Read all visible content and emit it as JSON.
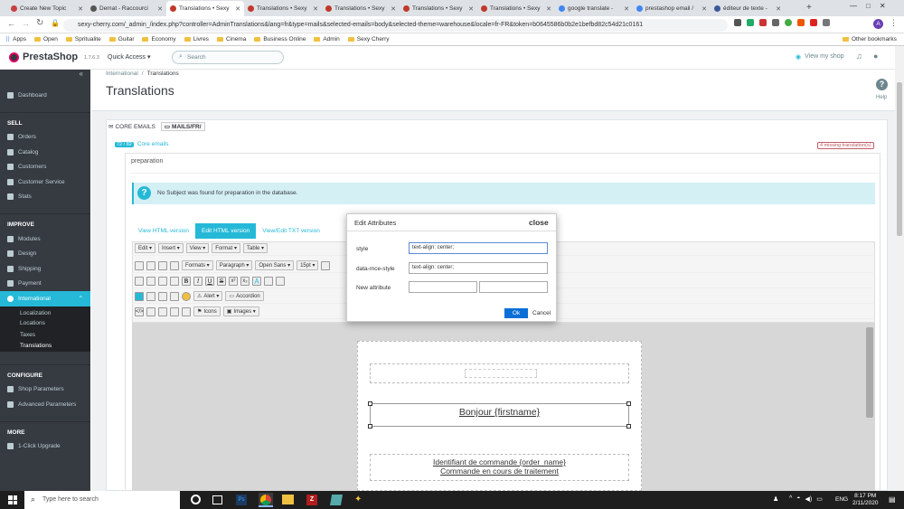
{
  "browser": {
    "tabs": [
      {
        "label": "Create New Topic",
        "color": "#c74040",
        "icon": "gmail-icon"
      },
      {
        "label": "Demat - Raccourci",
        "color": "#555",
        "icon": "page-icon"
      },
      {
        "label": "Translations • Sexy",
        "color": "#c0392b",
        "icon": "prestashop-icon",
        "active": true
      },
      {
        "label": "Translations • Sexy",
        "color": "#c0392b",
        "icon": "prestashop-icon"
      },
      {
        "label": "Translations • Sexy",
        "color": "#c0392b",
        "icon": "prestashop-icon"
      },
      {
        "label": "Translations • Sexy",
        "color": "#c0392b",
        "icon": "prestashop-icon"
      },
      {
        "label": "Translations • Sexy",
        "color": "#c0392b",
        "icon": "prestashop-icon"
      },
      {
        "label": "google translate -",
        "color": "#4285f4",
        "icon": "google-icon"
      },
      {
        "label": "prestashop email /",
        "color": "#4285f4",
        "icon": "google-icon"
      },
      {
        "label": "éditeur de texte -",
        "color": "#3b5998",
        "icon": "page-icon"
      }
    ],
    "url": "sexy-cherry.com/_admin_/index.php?controller=AdminTranslations&lang=fr&type=mails&selected-emails=body&selected-theme=warehouse&locale=fr-FR&token=b0645586b0b2e1befbd82c54d21c0161",
    "avatar": "A",
    "bookmarks": [
      "Apps",
      "Open",
      "Spritualite",
      "Guitar",
      "Economy",
      "Livres",
      "Cinema",
      "Business Online",
      "Admin",
      "Sexy Cherry"
    ],
    "other_bookmarks": "Other bookmarks"
  },
  "ps": {
    "brand": "PrestaShop",
    "version": "1.7.6.3",
    "quick_access": "Quick Access ▾",
    "search_placeholder": "Search",
    "view_shop": "View my shop",
    "help": "Help",
    "breadcrumb": [
      "International",
      "/",
      "Translations"
    ],
    "page_title": "Translations"
  },
  "sidebar": {
    "collapse": "«",
    "dashboard": "Dashboard",
    "sell": "SELL",
    "sell_items": [
      "Orders",
      "Catalog",
      "Customers",
      "Customer Service",
      "Stats"
    ],
    "improve": "IMPROVE",
    "improve_items": [
      "Modules",
      "Design",
      "Shipping",
      "Payment",
      "International"
    ],
    "international_sub": [
      "Localization",
      "Locations",
      "Taxes",
      "Translations"
    ],
    "configure": "CONFIGURE",
    "configure_items": [
      "Shop Parameters",
      "Advanced Parameters"
    ],
    "more": "MORE",
    "more_items": [
      "1-Click Upgrade"
    ]
  },
  "editor": {
    "core_emails_tab": "CORE EMAILS",
    "mails_path": "MAILS/FR/",
    "count_badge": "72 / 82",
    "core_emails_label": "Core emails",
    "missing": "4 missing translation(s)",
    "template_name": "preparation",
    "info": "No Subject was found for preparation in the database.",
    "view_tabs": [
      "View HTML version",
      "Edit HTML version",
      "View/Edit TXT version"
    ],
    "menu": [
      "Edit ▾",
      "Insert ▾",
      "View ▾",
      "Format ▾",
      "Table ▾"
    ],
    "formats": "Formats ▾",
    "paragraph": "Paragraph ▾",
    "font": "Open Sans ▾",
    "size": "15pt ▾",
    "alert": "Alert ▾",
    "accordion": "Accordion",
    "icons": "Icons",
    "images": "Images ▾"
  },
  "email_preview": {
    "greeting": "Bonjour {firstname}",
    "line1": "Identifiant de commande {order_name}",
    "line2": "Commande en cours de traitement"
  },
  "modal": {
    "title": "Edit Attributes",
    "close": "close",
    "rows": [
      {
        "label": "style",
        "value": "text-align: center;"
      },
      {
        "label": "data-mce-style",
        "value": "text-align: center;"
      },
      {
        "label": "New attribute",
        "value": ""
      }
    ],
    "ok": "Ok",
    "cancel": "Cancel"
  },
  "taskbar": {
    "search": "Type here to search",
    "lang": "ENG",
    "time": "8:17 PM",
    "date": "2/11/2020"
  },
  "colors": {
    "accent": "#25b9d7",
    "sidebar": "#363a41",
    "brand_red": "#df0067"
  }
}
